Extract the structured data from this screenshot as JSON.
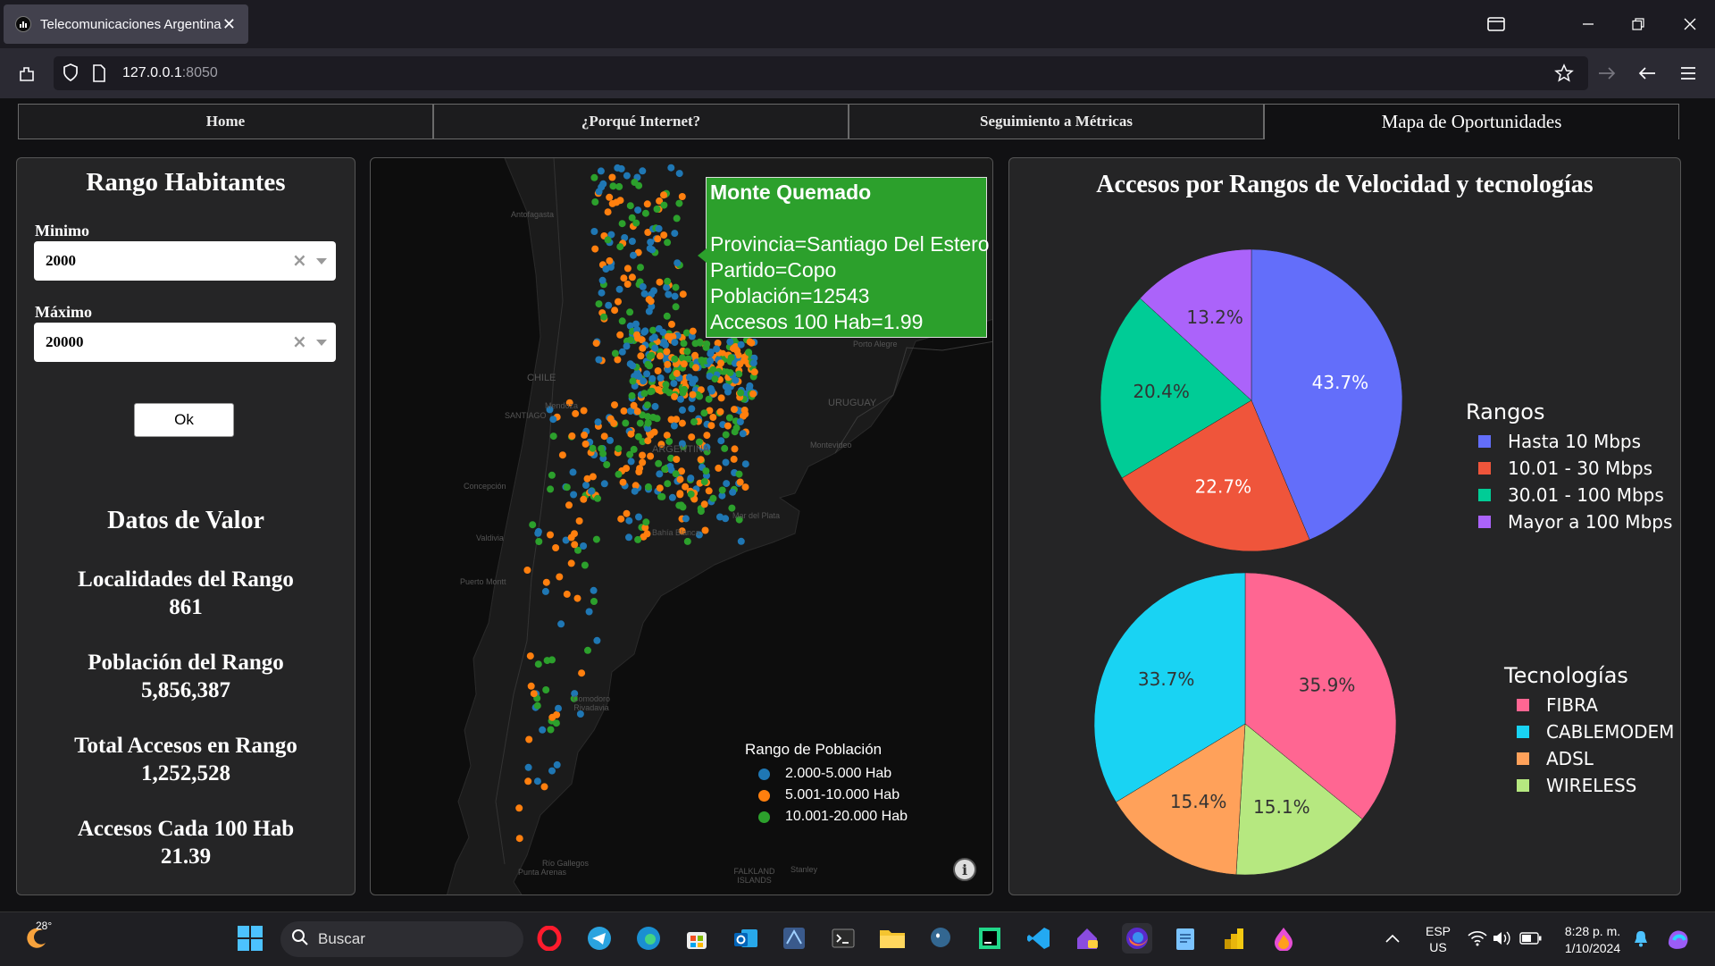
{
  "browser": {
    "tab_title": "Telecomunicaciones Argentina",
    "tab_close": "✕",
    "url_host": "127.0.0.1",
    "url_port": ":8050"
  },
  "nav_tabs": [
    {
      "label": "Home"
    },
    {
      "label": "¿Porqué Internet?"
    },
    {
      "label": "Seguimiento a Métricas"
    },
    {
      "label": "Mapa de Oportunidades"
    }
  ],
  "filters": {
    "title": "Rango Habitantes",
    "min_label": "Minimo",
    "min_value": "2000",
    "max_label": "Máximo",
    "max_value": "20000",
    "clear_glyph": "×",
    "ok_label": "Ok"
  },
  "stats": {
    "title": "Datos de Valor",
    "items": [
      {
        "label": "Localidades del Rango",
        "value": "861"
      },
      {
        "label": "Población del Rango",
        "value": "5,856,387"
      },
      {
        "label": "Total Accesos en Rango",
        "value": "1,252,528"
      },
      {
        "label": "Accesos Cada 100 Hab",
        "value": "21.39"
      }
    ]
  },
  "map": {
    "tooltip": {
      "title": "Monte Quemado",
      "lines": [
        "Provincia=Santiago Del Estero",
        "Partido=Copo",
        "Población=12543",
        "Accesos 100 Hab=1.99"
      ]
    },
    "legend_title": "Rango de Población",
    "legend": [
      {
        "label": "2.000-5.000 Hab",
        "color": "#1f77b4"
      },
      {
        "label": "5.001-10.000 Hab",
        "color": "#ff7f0e"
      },
      {
        "label": "10.001-20.000 Hab",
        "color": "#2ca02c"
      }
    ],
    "place_labels": [
      "Antofagasta",
      "CHILE",
      "Mendoza",
      "SANTIAGO",
      "ARGENTINA",
      "URUGUAY",
      "Montevideo",
      "Porto Alegre",
      "Concepción",
      "Valdivia",
      "Puerto Montt",
      "Bahía Blanca",
      "Mar del Plata",
      "Comodoro Rivadavia",
      "Punta Arenas",
      "Río Gallegos",
      "FALKLAND ISLANDS",
      "Stanley"
    ],
    "info_glyph": "i"
  },
  "charts": {
    "title": "Accesos por Rangos de Velocidad y tecnologías"
  },
  "chart_data": [
    {
      "type": "pie",
      "legend_title": "Rangos",
      "categories": [
        "Hasta 10 Mbps",
        "10.01 - 30 Mbps",
        "30.01 - 100 Mbps",
        "Mayor a 100 Mbps"
      ],
      "values": [
        43.7,
        22.7,
        20.4,
        13.2
      ],
      "labels": [
        "43.7%",
        "22.7%",
        "20.4%",
        "13.2%"
      ],
      "colors": [
        "#636efa",
        "#ef553b",
        "#00cc96",
        "#ab63fa"
      ]
    },
    {
      "type": "pie",
      "legend_title": "Tecnologías",
      "categories": [
        "FIBRA",
        "CABLEMODEM",
        "ADSL",
        "WIRELESS"
      ],
      "values": [
        35.9,
        33.7,
        15.4,
        15.1
      ],
      "labels": [
        "35.9%",
        "33.7%",
        "15.4%",
        "15.1%"
      ],
      "slice_order": [
        "FIBRA",
        "WIRELESS",
        "ADSL",
        "CABLEMODEM"
      ],
      "colors": [
        "#ff6692",
        "#19d3f3",
        "#ffa15a",
        "#b6e880"
      ]
    }
  ],
  "taskbar": {
    "weather": "28°",
    "search_placeholder": "Buscar",
    "lang": "ESP",
    "region": "US",
    "time": "8:28 p. m.",
    "date": "1/10/2024"
  }
}
